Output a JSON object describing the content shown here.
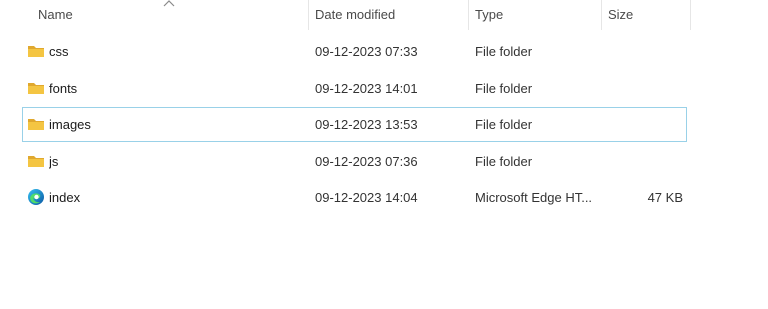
{
  "columns": {
    "name": "Name",
    "date_modified": "Date modified",
    "type": "Type",
    "size": "Size"
  },
  "files": [
    {
      "icon": "folder-icon",
      "name": "css",
      "date": "09-12-2023 07:33",
      "type": "File folder",
      "size": ""
    },
    {
      "icon": "folder-icon",
      "name": "fonts",
      "date": "09-12-2023 14:01",
      "type": "File folder",
      "size": ""
    },
    {
      "icon": "folder-icon",
      "name": "images",
      "date": "09-12-2023 13:53",
      "type": "File folder",
      "size": "",
      "selected": true
    },
    {
      "icon": "folder-icon",
      "name": "js",
      "date": "09-12-2023 07:36",
      "type": "File folder",
      "size": ""
    },
    {
      "icon": "edge-icon",
      "name": "index",
      "date": "09-12-2023 14:04",
      "type": "Microsoft Edge HT...",
      "size": "47 KB"
    }
  ],
  "colors": {
    "folder": "#f4c542",
    "folder_dark": "#e0a82e",
    "selection_border": "#99d1e8"
  }
}
